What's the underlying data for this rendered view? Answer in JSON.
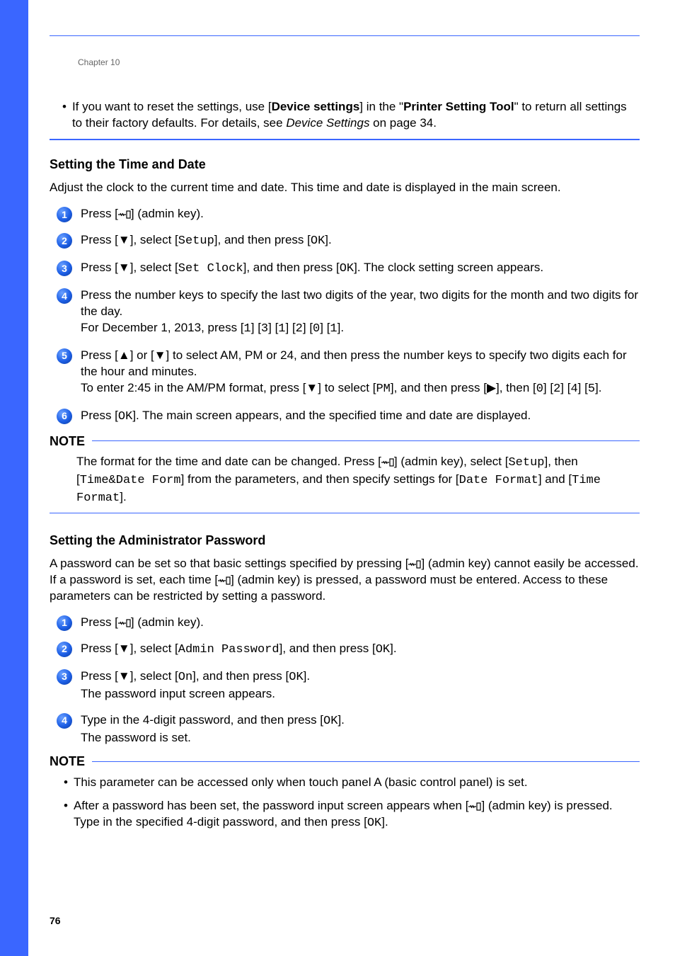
{
  "chapter": "Chapter 10",
  "page_number": "76",
  "intro_bullet": {
    "pre": "If you want to reset the settings, use [",
    "bold1": "Device settings",
    "mid1": "] in the \"",
    "bold2": "Printer Setting Tool",
    "mid2": "\" to return all settings to their factory defaults. For details, see ",
    "italic": "Device Settings",
    "post": " on page 34."
  },
  "section_time": {
    "heading": "Setting the Time and Date",
    "intro": "Adjust the clock to the current time and date. This time and date is displayed in the main screen.",
    "steps": {
      "s1": {
        "pre": "Press [",
        "post": "] (admin key)."
      },
      "s2": {
        "pre": "Press [▼], select [",
        "code1": "Setup",
        "mid": "], and then press [",
        "code2": "OK",
        "post": "]."
      },
      "s3": {
        "pre": "Press [▼], select [",
        "code1": "Set Clock",
        "mid": "], and then press [",
        "code2": "OK",
        "post": "]. The clock setting screen appears."
      },
      "s4": {
        "line1": "Press the number keys to specify the last two digits of the year, two digits for the month and two digits for the day.",
        "line2_pre": "For December 1, 2013, press [",
        "d1": "1",
        "d2": "3",
        "d3": "1",
        "d4": "2",
        "d5": "0",
        "d6": "1",
        "line2_post": "]."
      },
      "s5": {
        "line1": "Press [▲] or [▼] to select AM, PM or 24, and then press the number keys to specify two digits each for the hour and minutes.",
        "line2_pre": "To enter 2:45 in the AM/PM format, press [▼] to select [",
        "pm": "PM",
        "line2_mid": "], and then press [▶], then [",
        "t1": "0",
        "t2": "2",
        "t3": "4",
        "t4": "5",
        "line2_post": "]."
      },
      "s6": {
        "pre": "Press [",
        "code1": "OK",
        "post": "]. The main screen appears, and the specified time and date are displayed."
      }
    },
    "note": {
      "label": "NOTE",
      "body_pre": "The format for the time and date can be changed. Press [",
      "body_mid1": "] (admin key), select [",
      "setup": "Setup",
      "body_mid2": "], then [",
      "tdform": "Time&Date Form",
      "body_mid3": "] from the parameters, and then specify settings for [",
      "dformat": "Date Format",
      "body_mid4": "] and [",
      "tformat": "Time Format",
      "body_post": "]."
    }
  },
  "section_pwd": {
    "heading": "Setting the Administrator Password",
    "intro_pre": "A password can be set so that basic settings specified by pressing [",
    "intro_mid1": "] (admin key) cannot easily be accessed. If a password is set, each time [",
    "intro_mid2": "] (admin key) is pressed, a password must be entered. Access to these parameters can be restricted by setting a password.",
    "steps": {
      "s1": {
        "pre": "Press [",
        "post": "] (admin key)."
      },
      "s2": {
        "pre": "Press [▼], select [",
        "code1": "Admin Password",
        "mid": "], and then press [",
        "code2": "OK",
        "post": "]."
      },
      "s3": {
        "pre": "Press [▼], select [",
        "code1": "On",
        "mid": "], and then press [",
        "code2": "OK",
        "post": "].",
        "line2": "The password input screen appears."
      },
      "s4": {
        "pre": "Type in the 4-digit password, and then press [",
        "code1": "OK",
        "post": "].",
        "line2": "The password is set."
      }
    },
    "note": {
      "label": "NOTE",
      "b1": "This parameter can be accessed only when touch panel A (basic control panel) is set.",
      "b2_pre": "After a password has been set, the password input screen appears when [",
      "b2_mid": "] (admin key) is pressed. Type in the specified 4-digit password, and then press [",
      "ok": "OK",
      "b2_post": "]."
    }
  }
}
